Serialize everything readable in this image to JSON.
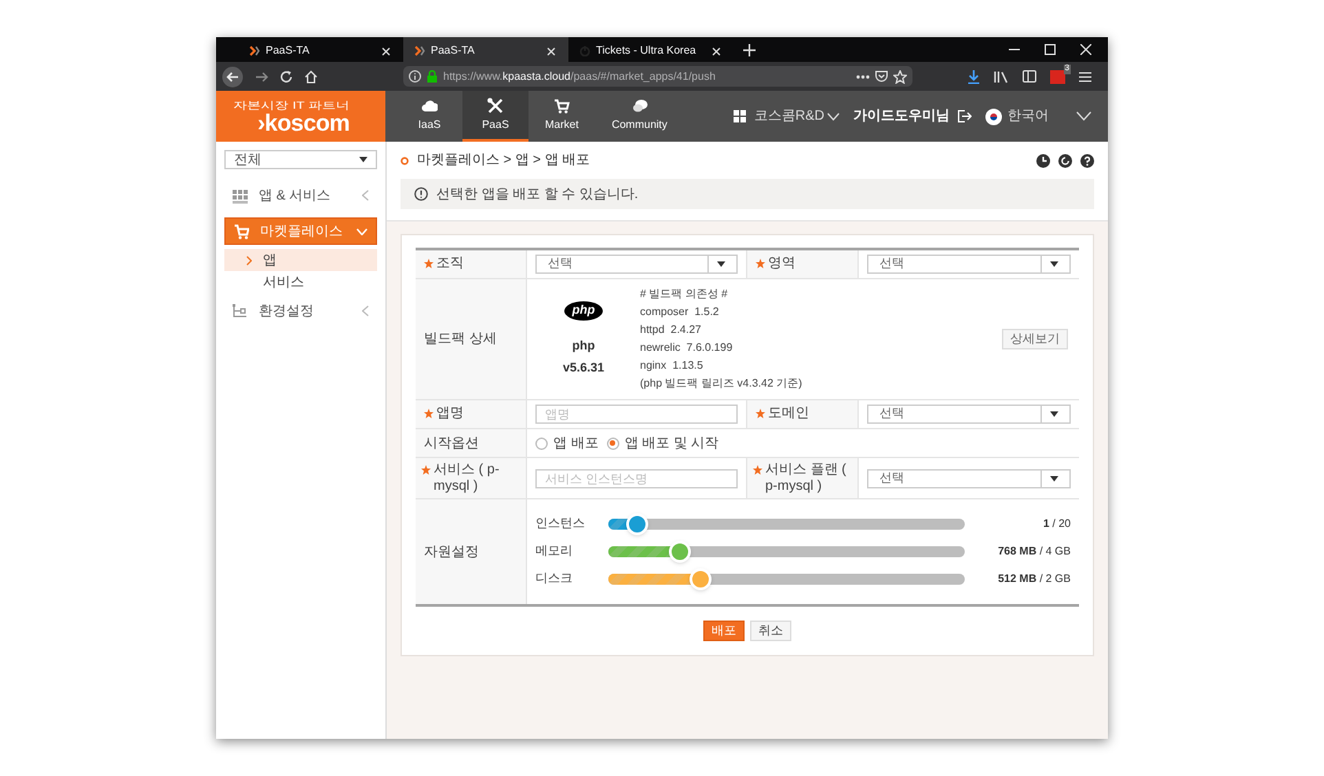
{
  "browser": {
    "tabs": [
      {
        "title": "PaaS-TA",
        "kind": "koscom",
        "selected": false
      },
      {
        "title": "PaaS-TA",
        "kind": "koscom",
        "selected": true
      },
      {
        "title": "Tickets - Ultra Korea",
        "kind": "power",
        "selected": false
      }
    ],
    "url": {
      "prefix": "https://www.",
      "domain": "kpaasta.cloud",
      "path": "/paas/#/market_apps/41/push"
    },
    "extension_badge": "3"
  },
  "header": {
    "logo": {
      "tagline": "자본시장 IT 파트너",
      "name": "›koscom"
    },
    "nav": [
      {
        "label": "IaaS",
        "kind": "cloud",
        "selected": false
      },
      {
        "label": "PaaS",
        "kind": "tools",
        "selected": true
      },
      {
        "label": "Market",
        "kind": "cart",
        "selected": false
      },
      {
        "label": "Community",
        "kind": "chat",
        "selected": false
      }
    ],
    "org": "코스콤R&D",
    "user": "가이드도우미님",
    "language": "한국어"
  },
  "sidebar": {
    "filter": "전체",
    "items": [
      {
        "label": "앱 & 서비스",
        "kind": "apps",
        "selected": false,
        "expanded": false
      },
      {
        "label": "마켓플레이스",
        "kind": "cart",
        "selected": true,
        "expanded": true,
        "children": [
          {
            "label": "앱",
            "selected": true
          },
          {
            "label": "서비스",
            "selected": false
          }
        ]
      },
      {
        "label": "환경설정",
        "kind": "settings",
        "selected": false,
        "expanded": false
      }
    ]
  },
  "breadcrumb": "마켓플레이스 > 앱 > 앱 배포",
  "notice": "선택한 앱을 배포 할 수 있습니다.",
  "form": {
    "org": {
      "label": "조직",
      "required": true,
      "value": "선택"
    },
    "region": {
      "label": "영역",
      "required": true,
      "value": "선택"
    },
    "buildpack": {
      "label": "빌드팩 상세",
      "logo": "php",
      "name": "php",
      "version": "v5.6.31",
      "dependencies": [
        "# 빌드팩 의존성 #",
        "composer  1.5.2",
        "httpd  2.4.27",
        "newrelic  7.6.0.199",
        "nginx  1.13.5",
        "(php 빌드팩 릴리즈 v4.3.42 기준)"
      ],
      "detail_button": "상세보기"
    },
    "app_name": {
      "label": "앱명",
      "required": true,
      "placeholder": "앱명"
    },
    "domain": {
      "label": "도메인",
      "required": true,
      "value": "선택"
    },
    "start_option": {
      "label": "시작옵션",
      "options": [
        {
          "label": "앱 배포",
          "selected": false
        },
        {
          "label": "앱 배포 및 시작",
          "selected": true
        }
      ]
    },
    "service": {
      "label": "서비스 ( p-mysql )",
      "required": true,
      "placeholder": "서비스 인스턴스명"
    },
    "service_plan": {
      "label": "서비스 플랜 ( p-mysql )",
      "required": true,
      "value": "선택"
    },
    "resources": {
      "label": "자원설정",
      "sliders": [
        {
          "label": "인스턴스",
          "level": 0.08,
          "color": "#1a9ed4",
          "value": "1",
          "limit": "/ 20"
        },
        {
          "label": "메모리",
          "level": 0.2,
          "color": "#6cc04a",
          "value": "768 MB",
          "limit": "/ 4 GB"
        },
        {
          "label": "디스크",
          "level": 0.26,
          "color": "#fbb040",
          "value": "512 MB",
          "limit": "/ 2 GB"
        }
      ]
    }
  },
  "buttons": [
    {
      "label": "배포",
      "kind": "primary"
    },
    {
      "label": "취소",
      "kind": "secondary"
    }
  ]
}
